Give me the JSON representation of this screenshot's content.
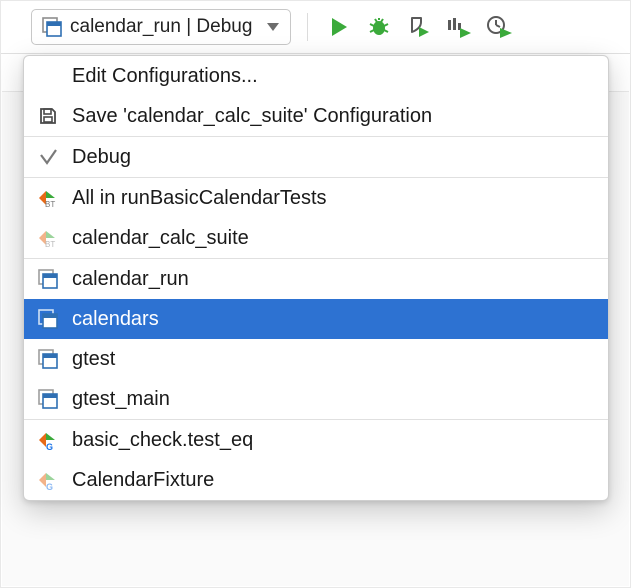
{
  "toolbar": {
    "run_config_label": "calendar_run | Debug"
  },
  "dropdown": {
    "edit_config": "Edit Configurations...",
    "save_config": "Save 'calendar_calc_suite' Configuration",
    "profile_label": "Debug",
    "items_a": [
      {
        "label": "All in runBasicCalendarTests"
      },
      {
        "label": "calendar_calc_suite"
      }
    ],
    "items_b": [
      {
        "label": "calendar_run",
        "selected": false
      },
      {
        "label": "calendars",
        "selected": true
      },
      {
        "label": "gtest",
        "selected": false
      },
      {
        "label": "gtest_main",
        "selected": false
      }
    ],
    "items_c": [
      {
        "label": "basic_check.test_eq"
      },
      {
        "label": "CalendarFixture"
      }
    ]
  },
  "colors": {
    "green": "#4CAF50",
    "blue_sel": "#2D72D2",
    "orange": "#E86A17",
    "gray": "#7a7a7a"
  }
}
